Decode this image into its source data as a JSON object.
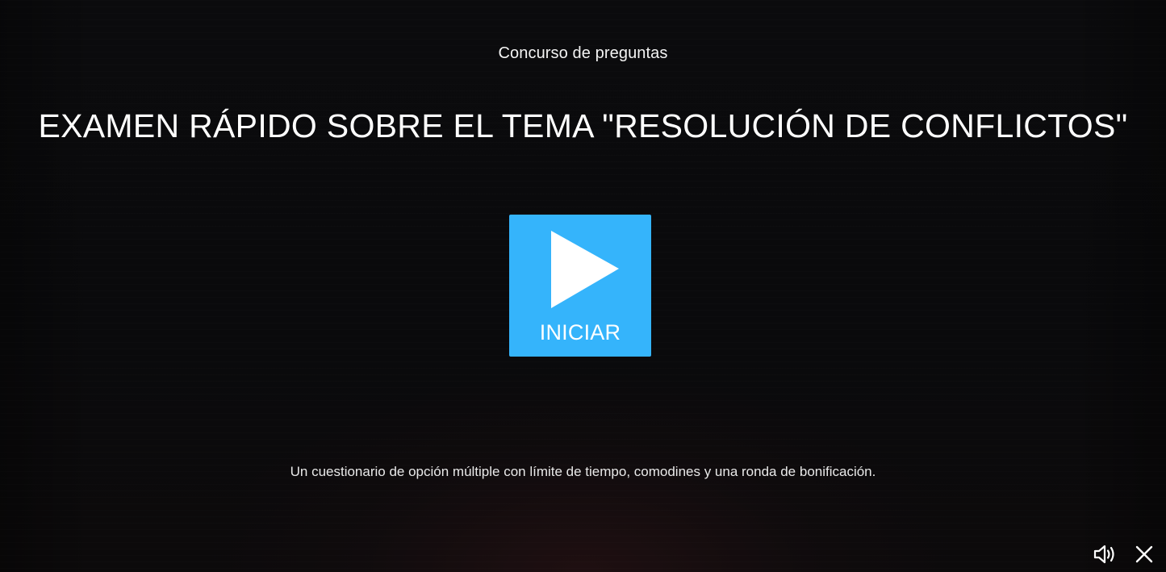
{
  "quiz": {
    "kicker": "Concurso de preguntas",
    "title": "EXAMEN RÁPIDO SOBRE EL TEMA \"RESOLUCIÓN DE CONFLICTOS\"",
    "description": "Un cuestionario de opción múltiple con límite de tiempo, comodines y una ronda de bonificación."
  },
  "start_button": {
    "label": "INICIAR",
    "icon": "play-icon",
    "color": "#35b4fb"
  },
  "controls": {
    "sound_icon": "speaker-icon",
    "close_icon": "close-icon"
  }
}
